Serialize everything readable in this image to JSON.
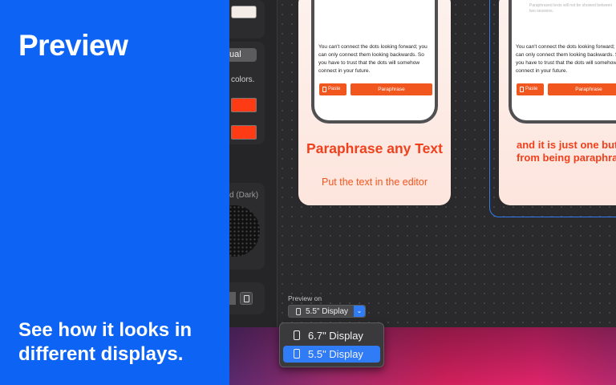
{
  "promo": {
    "title": "Preview",
    "subtitle": "See how it looks in different displays."
  },
  "sidebar": {
    "select_value": "ual",
    "colors_text": "colors.",
    "appearance_label": "d (Dark)"
  },
  "artboard1": {
    "quote": "You can't connect the dots looking forward; you can only connect them looking backwards. So you have to trust that the dots will somehow connect in your future.",
    "paste_label": "Paste",
    "paraphrase_label": "Paraphrase",
    "headline": "Paraphrase any Text",
    "subline": "Put the text in the editor"
  },
  "artboard2": {
    "faded_text": "Paraphrased texts will not be showed between two sessions.",
    "quote": "You can't connect the dots looking forward; you can only connect them looking backwards. So you have to trust that the dots will somehow connect in your future.",
    "paste_label": "Paste",
    "paraphrase_label": "Paraphrase",
    "headline": "and it is just one button away from being paraphrased"
  },
  "preview": {
    "label": "Preview on",
    "selected": "5.5\" Display",
    "options": [
      "6.7\" Display",
      "5.5\" Display"
    ]
  },
  "colors": {
    "promo_bg": "#0d63f4",
    "accent": "#f0561e",
    "selection": "#2f7cf6"
  }
}
